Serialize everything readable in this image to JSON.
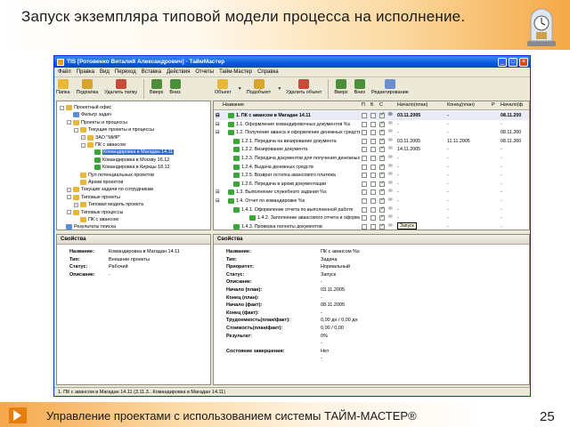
{
  "slide": {
    "title": "Запуск  экземпляра типовой модели процесса на исполнение.",
    "footer": "Управление проектами с использованием системы ТАЙМ-МАСТЕР®",
    "page_number": "25"
  },
  "window": {
    "title": "TIS [Ротовенко Виталий Александрович] - ТаймМастер",
    "menu": [
      "Файл",
      "Правка",
      "Вид",
      "Переход",
      "Вставка",
      "Действия",
      "Отчеты",
      "Тайм-Мастер",
      "Справка"
    ],
    "toolbar_left": [
      "Папка",
      "Подпапка",
      "Удалить папку",
      "Вверх",
      "Вниз"
    ],
    "toolbar_right": [
      "Объект",
      "Подобъект",
      "Удалить объект",
      "Вверх",
      "Вниз",
      "Редактирование"
    ]
  },
  "tree": [
    {
      "label": "Проектный офис",
      "level": 0,
      "exp": "-",
      "color": "#e8b73a"
    },
    {
      "label": "Фильтр задач",
      "level": 1,
      "exp": "",
      "color": "#5a8fd8"
    },
    {
      "label": "Проекты и процессы",
      "level": 1,
      "exp": "-",
      "color": "#e8b73a"
    },
    {
      "label": "Текущие проекты и процессы",
      "level": 2,
      "exp": "-",
      "color": "#e8b73a"
    },
    {
      "label": "ЗАО \"МИР\"",
      "level": 3,
      "exp": "+",
      "color": "#e8b73a"
    },
    {
      "label": "ПК с авансом",
      "level": 3,
      "exp": "-",
      "color": "#e8b73a"
    },
    {
      "label": "Командировка в Магадан 14.11",
      "level": 4,
      "exp": "",
      "color": "#3aa63a",
      "selected": true
    },
    {
      "label": "Командировка в Москву 16.12",
      "level": 4,
      "exp": "",
      "color": "#3aa63a"
    },
    {
      "label": "Командировка в Киркцы 18.12",
      "level": 4,
      "exp": "",
      "color": "#3aa63a"
    },
    {
      "label": "Пул потенциальных проектов",
      "level": 2,
      "exp": "",
      "color": "#e8b73a"
    },
    {
      "label": "Архив проектов",
      "level": 2,
      "exp": "",
      "color": "#e8b73a"
    },
    {
      "label": "Текущие задачи по сотрудникам",
      "level": 1,
      "exp": "+",
      "color": "#e8b73a"
    },
    {
      "label": "Типовые проекты",
      "level": 1,
      "exp": "-",
      "color": "#e8b73a"
    },
    {
      "label": "Типовая модель проекта",
      "level": 2,
      "exp": "+",
      "color": "#e8b73a"
    },
    {
      "label": "Типовые процессы",
      "level": 1,
      "exp": "-",
      "color": "#e8b73a"
    },
    {
      "label": "ПК с авансом",
      "level": 2,
      "exp": "",
      "color": "#e8b73a"
    },
    {
      "label": "Результаты поиска",
      "level": 0,
      "exp": "",
      "color": "#5a8fd8"
    }
  ],
  "grid": {
    "headers": {
      "name": "Название",
      "p": "П",
      "b": "Б",
      "c": "С",
      "start_plan": "Начало(план)",
      "end_plan": "Конец(план)",
      "p2": "P",
      "start_fact": "Начало(ф"
    },
    "rows": [
      {
        "name": "1. ПК с авансом в Магадан 14.11",
        "start_plan": "03.11.2005",
        "end_plan": "-",
        "start_fact": "08.11.200",
        "selected": true
      },
      {
        "name": "1.1. Оформление командировочных документов %s",
        "start_plan": "-",
        "end_plan": "-",
        "start_fact": "-"
      },
      {
        "name": "1.2. Получение аванса и оформление денежных средств %s",
        "start_plan": "-",
        "end_plan": "-",
        "start_fact": "08.11.200"
      },
      {
        "name": "1.2.1. Передача на визирование документа",
        "start_plan": "03.11.2005",
        "end_plan": "11.11.2005",
        "start_fact": "08.11.200"
      },
      {
        "name": "1.2.2. Визирование документа",
        "start_plan": "14.11.2005",
        "end_plan": "-",
        "start_fact": "-"
      },
      {
        "name": "1.2.3. Передача документов для получения денежных средств",
        "start_plan": "-",
        "end_plan": "-",
        "start_fact": "-"
      },
      {
        "name": "1.2.4. Выдача денежных средств",
        "start_plan": "-",
        "end_plan": "-",
        "start_fact": "-"
      },
      {
        "name": "1.2.5. Возврат остатка авансового платежа",
        "start_plan": "-",
        "end_plan": "-",
        "start_fact": "-"
      },
      {
        "name": "1.2.6. Передача в архив документации",
        "start_plan": "-",
        "end_plan": "-",
        "start_fact": "-"
      },
      {
        "name": "1.3. Выполнение служебного задания %s",
        "start_plan": "-",
        "end_plan": "-",
        "start_fact": "-"
      },
      {
        "name": "1.4. Отчет по командировке %s",
        "start_plan": "-",
        "end_plan": "-",
        "start_fact": "-"
      },
      {
        "name": "1.4.1. Оформление отчета по выполненной работе",
        "start_plan": "-",
        "end_plan": "-",
        "start_fact": "-"
      },
      {
        "name": "1.4.2. Заполнение авансового отчета и оформление...",
        "start_plan": "-",
        "end_plan": "-",
        "start_fact": "-"
      },
      {
        "name": "1.4.3. Проверка полноты документов",
        "start_plan": "-",
        "end_plan": "-",
        "start_fact": "-"
      }
    ],
    "tooltip": "Запуск"
  },
  "props_left": {
    "title": "Свойства",
    "rows": [
      {
        "k": "Название:",
        "v": "Командировка в Магадан 14.11"
      },
      {
        "k": "Тип:",
        "v": "Внешние проекты"
      },
      {
        "k": "Статус:",
        "v": "Рабочий"
      },
      {
        "k": "Описание:",
        "v": "-"
      }
    ]
  },
  "props_right": {
    "title": "Свойства",
    "rows": [
      {
        "k": "Название:",
        "v": "ПК с авансом %s"
      },
      {
        "k": "Тип:",
        "v": "Задача"
      },
      {
        "k": "Приоритет:",
        "v": "Нормальный"
      },
      {
        "k": "Статус:",
        "v": "Запуск"
      },
      {
        "k": "Описание:",
        "v": "-"
      },
      {
        "k": "Начало (план):",
        "v": "03.11.2005"
      },
      {
        "k": "Конец (план):",
        "v": "-"
      },
      {
        "k": "Начало (факт):",
        "v": "08.11.2005"
      },
      {
        "k": "Конец (факт):",
        "v": "-"
      },
      {
        "k": "Трудоемкость(план/факт):",
        "v": "0,00 дн / 0,00 дн"
      },
      {
        "k": "Стоимость(план/факт):",
        "v": "0,00 / 0,00"
      },
      {
        "k": "Результат:",
        "v": "0%"
      },
      {
        "k": "",
        "v": "-"
      },
      {
        "k": "Состояние завершения:",
        "v": "Нет"
      },
      {
        "k": "",
        "v": "-"
      }
    ]
  },
  "statusbar": "1. ПК с авансом в Магадан 14.11 (3.11.3.. Командировка в Магадан 14.11)",
  "colors": {
    "accent_orange": "#f5a845",
    "titlebar_blue": "#0a5ae0",
    "selection": "#316ac5"
  }
}
